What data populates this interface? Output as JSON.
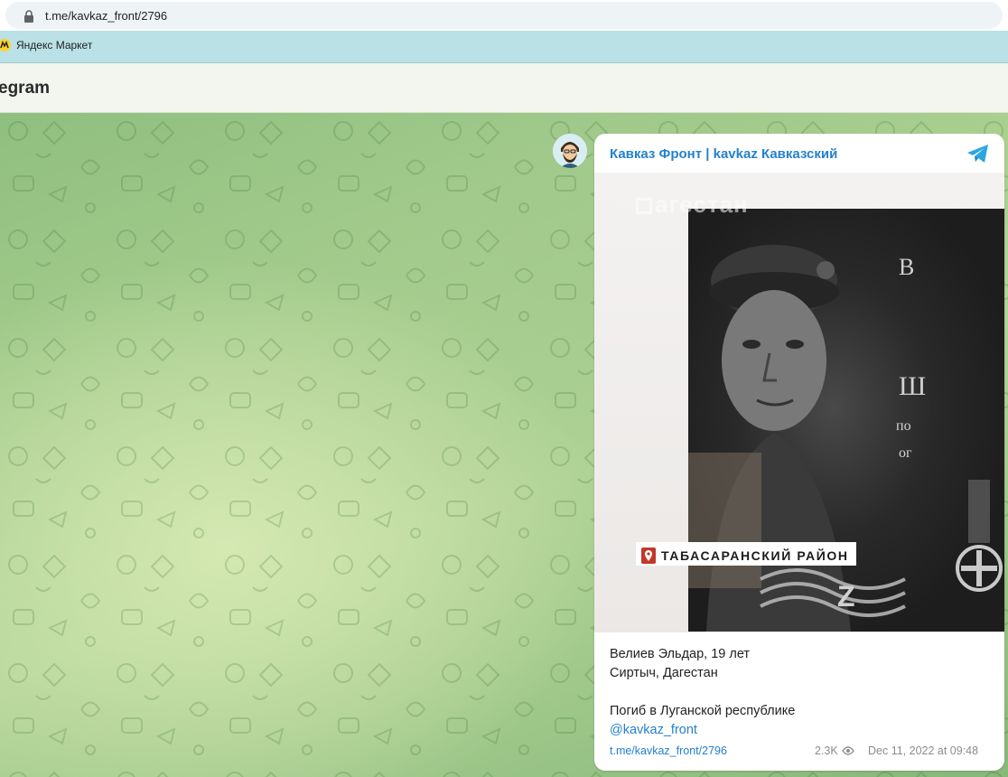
{
  "browser": {
    "url": "t.me/kavkaz_front/2796",
    "bookmarks": [
      {
        "label": "Яндекс Маркет",
        "icon": "yandex-market-icon"
      }
    ]
  },
  "header": {
    "title": "egram"
  },
  "message": {
    "channel_name": "Кавказ Фронт | kavkaz Кавказский",
    "photo": {
      "watermark": "агестан",
      "district_label": "ТАБАСАРАНСКИЙ РАЙОН",
      "plaque_text": [
        "В",
        "Ш",
        "по",
        "ог"
      ]
    },
    "text_lines": [
      "Велиев Эльдар, 19 лет",
      "Сиртыч, Дагестан",
      "",
      "Погиб в Луганской республике"
    ],
    "mention": "@kavkaz_front",
    "footer": {
      "link": "t.me/kavkaz_front/2796",
      "views": "2.3K",
      "date": "Dec 11, 2022 at 09:48"
    }
  },
  "colors": {
    "link": "#2481cc",
    "bookmark_bar": "#b9e1e6",
    "chat_background": "#a9cf8f"
  }
}
